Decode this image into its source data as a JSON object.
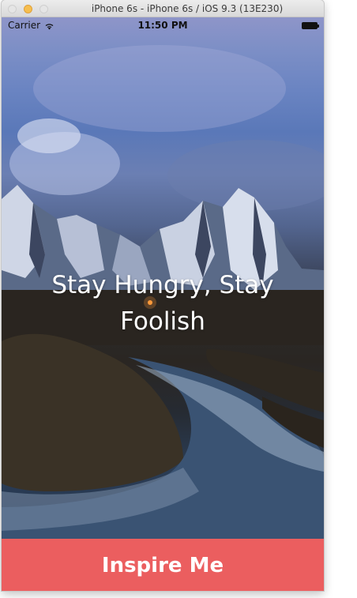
{
  "window": {
    "title": "iPhone 6s - iPhone 6s / iOS 9.3 (13E230)"
  },
  "status_bar": {
    "carrier": "Carrier",
    "time": "11:50 PM",
    "icons": [
      "wifi-icon",
      "battery-icon"
    ]
  },
  "main": {
    "quote": "Stay Hungry, Stay Foolish",
    "background": "mountain-landscape-photo"
  },
  "action": {
    "button_label": "Inspire Me",
    "button_color": "#eb5e5f"
  }
}
